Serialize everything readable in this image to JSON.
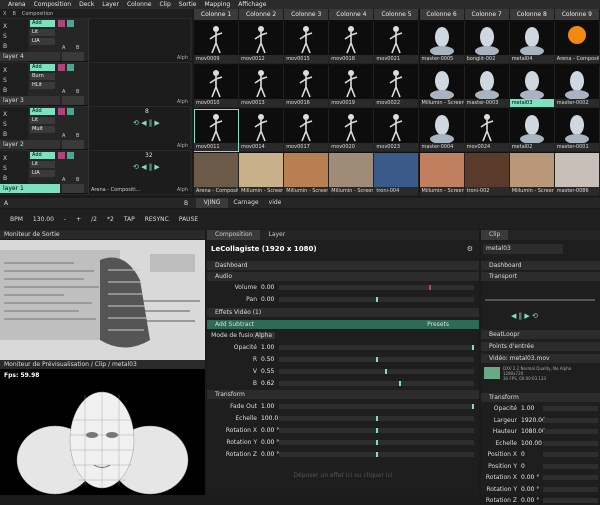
{
  "menu": [
    "Arena",
    "Composition",
    "Deck",
    "Layer",
    "Colonne",
    "Clip",
    "Sortie",
    "Mapping",
    "Affichage"
  ],
  "layers_header": {
    "x": "X",
    "b": "B",
    "title": "Composition"
  },
  "layers": [
    {
      "name": "layer 4",
      "blend": [
        "Add",
        "Lit",
        "LIA"
      ],
      "active": false
    },
    {
      "name": "layer 3",
      "blend": [
        "Add",
        "Burn",
        "HLit"
      ],
      "active": false
    },
    {
      "name": "layer 2",
      "blend": [
        "Add",
        "Lit",
        "Mult"
      ],
      "active": false,
      "clip_value": "8"
    },
    {
      "name": "layer 1",
      "blend": [
        "Add",
        "Lit",
        "LIA"
      ],
      "active": true,
      "clip_value": "32",
      "clip_label": "Arena - Compositi..."
    }
  ],
  "ab_labels": {
    "a": "A",
    "b": "B",
    "alph": "Alph"
  },
  "columns": [
    "Colonne 1",
    "Colonne 2",
    "Colonne 3",
    "Colonne 4",
    "Colonne 5",
    "Colonne 6",
    "Colonne 7",
    "Colonne 8",
    "Colonne 9"
  ],
  "grid": [
    [
      "mov0009",
      "mov0012",
      "mov0015",
      "mov0018",
      "mov0021",
      "master-0005",
      "bongiit-002",
      "metal04",
      "Arena - Compositi..."
    ],
    [
      "mov0010",
      "mov0013",
      "mov0016",
      "mov0019",
      "mov0022",
      "Millumin - Screen...",
      "master-0003",
      "metal03",
      "master-0002"
    ],
    [
      "mov0011",
      "mov0014",
      "mov0017",
      "mov0020",
      "mov0023",
      "master-0004",
      "mov0024",
      "metal02",
      "master-0001"
    ],
    [
      "Arena - Composit...",
      "Millumin - Screen...",
      "Millumin - Screen...",
      "Millumin - Screen...",
      "troni-004",
      "Millumin - Screen...",
      "troni-002",
      "Millumin - Screen...",
      "master-0086"
    ]
  ],
  "active_cell": "metal03",
  "deck": {
    "a": "A",
    "b": "B",
    "tabs": [
      "VJING",
      "Carnage",
      "vide"
    ]
  },
  "tempo": {
    "bpm_label": "BPM",
    "bpm": "130.00",
    "minus": "-",
    "plus": "+",
    "half": "/2",
    "double": "*2",
    "tap": "TAP",
    "resync": "RESYNC",
    "pause": "PAUSE"
  },
  "output": {
    "title": "Moniteur de Sortie"
  },
  "preview": {
    "title": "Moniteur de Prévisualisation / Clip / metal03",
    "fps": "Fps: 59.98"
  },
  "composition": {
    "tabs": [
      "Composition",
      "Layer"
    ],
    "title": "LeCollagiste (1920 x 1080)",
    "dashboard": "Dashboard",
    "audio": "Audio",
    "volume_label": "Volume",
    "volume": "0.00",
    "pan_label": "Pan",
    "pan": "0.00",
    "effects": "Effets Vidéo (1)",
    "effect_name": "Add Subtract",
    "presets": "Presets",
    "blend_mode_label": "Mode de fusion",
    "blend_mode": "Alpha",
    "params": [
      {
        "label": "Opacité",
        "value": "1.00",
        "level": 1.0
      },
      {
        "label": "R",
        "value": "0.50",
        "level": 0.5
      },
      {
        "label": "V",
        "value": "0.55",
        "level": 0.55
      },
      {
        "label": "B",
        "value": "0.62",
        "level": 0.62
      }
    ],
    "transform": "Transform",
    "transform_params": [
      {
        "label": "Fade Out",
        "value": "1.00",
        "level": 1.0
      },
      {
        "label": "Echelle",
        "value": "100.0",
        "level": 0.5
      },
      {
        "label": "Rotation X",
        "value": "0.00 °",
        "level": 0.5
      },
      {
        "label": "Rotation Y",
        "value": "0.00 °",
        "level": 0.5
      },
      {
        "label": "Rotation Z",
        "value": "0.00 °",
        "level": 0.5
      }
    ],
    "drop_hint": "Déposer un effet ici ou cliquer ici"
  },
  "clip": {
    "tab": "Clip",
    "name": "metal03",
    "dashboard": "Dashboard",
    "transport": "Transport",
    "beatloopr": "BeatLoopr",
    "points": "Points d'entrée",
    "video": "Vidéo: metal03.mov",
    "info": "DXV 2.2 Normal Quality, No Alpha\n1280x720\n30 FPS, 00:00:03.133",
    "transform": "Transform",
    "params": [
      {
        "label": "Opacité",
        "value": "1.00"
      },
      {
        "label": "Largeur",
        "value": "1920.00"
      },
      {
        "label": "Hauteur",
        "value": "1080.00"
      },
      {
        "label": "Echelle",
        "value": "100.00"
      },
      {
        "label": "Position X",
        "value": "0"
      },
      {
        "label": "Position Y",
        "value": "0"
      },
      {
        "label": "Rotation X",
        "value": "0.00 °"
      },
      {
        "label": "Rotation Y",
        "value": "0.00 °"
      },
      {
        "label": "Rotation Z",
        "value": "0.00 °"
      }
    ]
  }
}
